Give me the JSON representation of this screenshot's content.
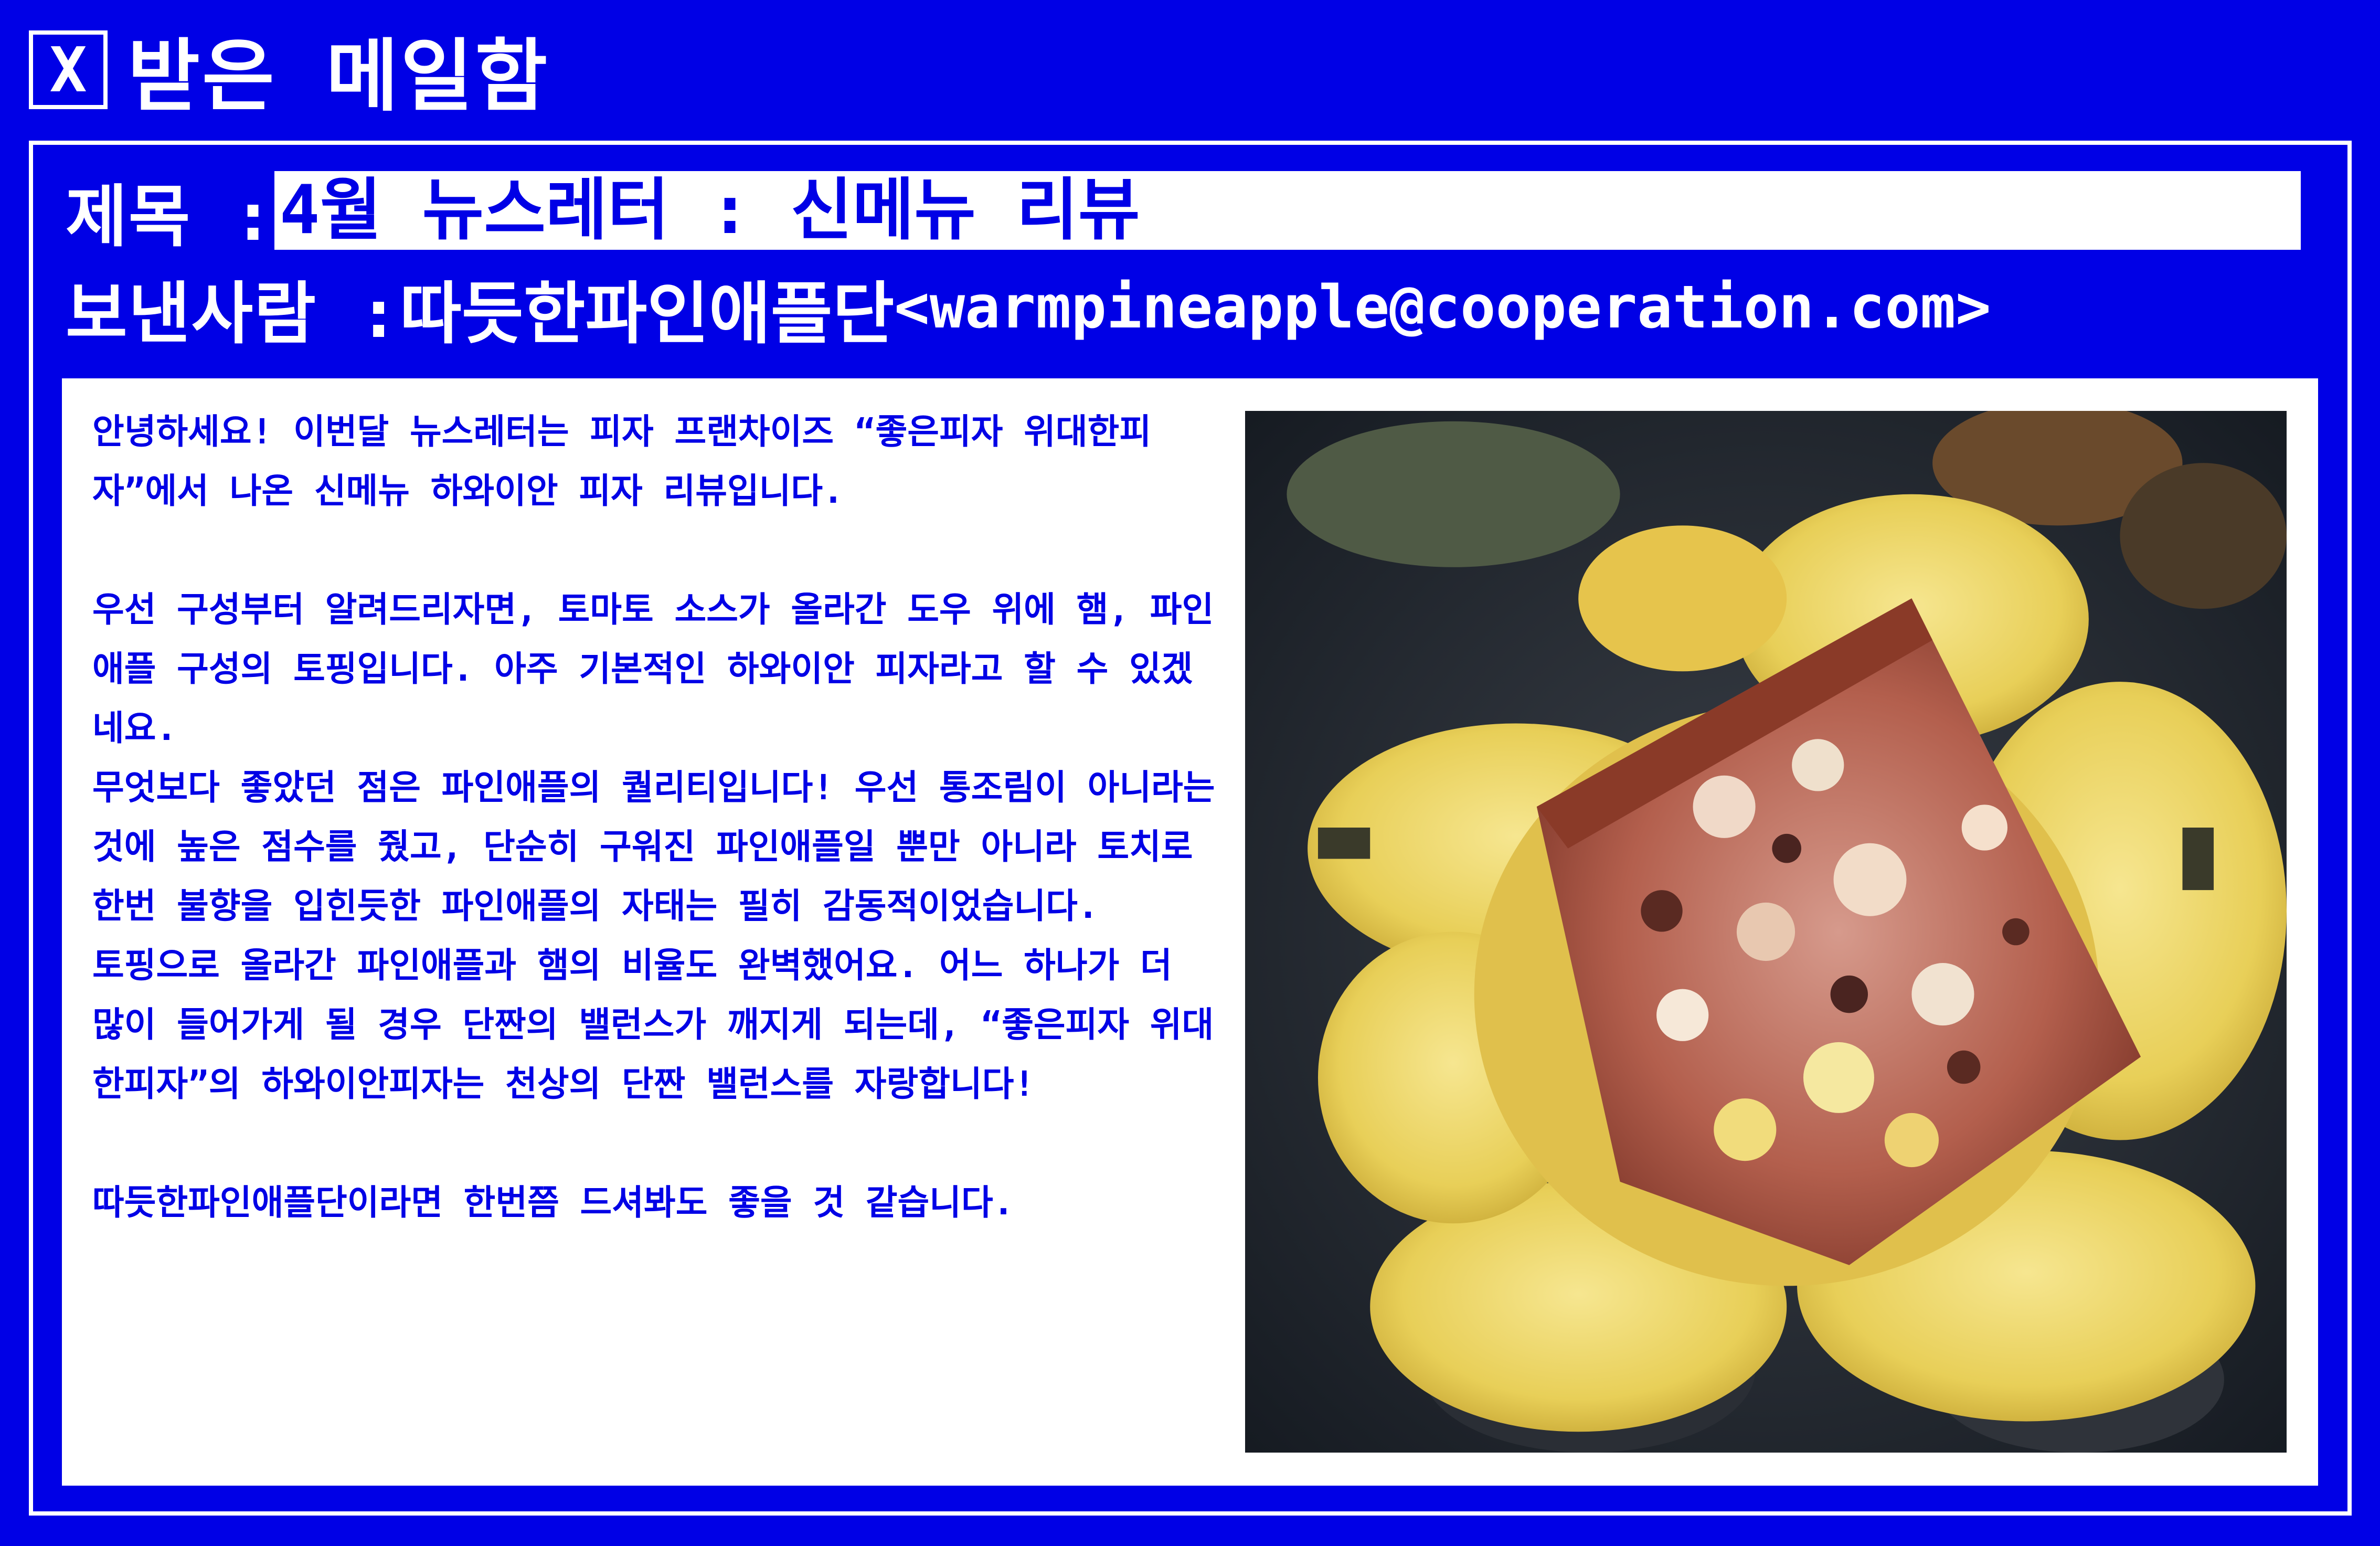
{
  "window": {
    "close_glyph": "X",
    "title": "받은 메일함"
  },
  "mail": {
    "subject_label": "제목 : ",
    "subject": "4월 뉴스레터 : 신메뉴 리뷰",
    "sender_label": "보낸사람 : ",
    "sender_name": "따듯한파인애플단",
    "sender_email": "<warmpineapple@cooperation.com>",
    "body_paragraphs": [
      "안녕하세요! 이번달 뉴스레터는 피자 프랜차이즈 “좋은피자 위대한피자”에서 나온 신메뉴 하와이안 피자 리뷰입니다.",
      "",
      "우선 구성부터 알려드리자면, 토마토 소스가 올라간 도우 위에 햄, 파인애플 구성의 토핑입니다. 아주 기본적인 하와이안 피자라고 할 수 있겠네요.",
      "무엇보다 좋았던 점은 파인애플의 퀄리티입니다! 우선 통조림이 아니라는 것에 높은 점수를 줬고, 단순히 구워진 파인애플일 뿐만 아니라 토치로 한번 불향을 입힌듯한 파인애플의 자태는 필히 감동적이었습니다.",
      "토핑으로 올라간 파인애플과 햄의 비율도 완벽했어요. 어느 하나가 더 많이 들어가게 될 경우 단짠의 밸런스가 깨지게 되는데, “좋은피자 위대한피자”의 하와이안피자는 천상의 단짠 밸런스를 자랑합니다!",
      "",
      "따듯한파인애플단이라면 한번쯤 드셔봐도 좋을 것 같습니다."
    ]
  },
  "image": {
    "subject": "pizza-slice-with-grilled-pineapple"
  }
}
